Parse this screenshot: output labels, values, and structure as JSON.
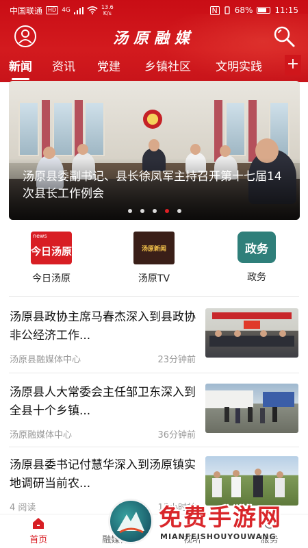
{
  "status_bar": {
    "carrier": "中国联通",
    "hd": "HD",
    "network": "4G",
    "speed_value": "13.6",
    "speed_unit": "K/s",
    "nfc": "N",
    "battery_percent": "68%",
    "time": "11:15"
  },
  "header": {
    "title": "汤原融媒"
  },
  "tabs": [
    {
      "label": "新闻",
      "active": true
    },
    {
      "label": "资讯",
      "active": false
    },
    {
      "label": "党建",
      "active": false
    },
    {
      "label": "乡镇社区",
      "active": false
    },
    {
      "label": "文明实践",
      "active": false
    }
  ],
  "tabs_more": "+",
  "banner": {
    "caption": "汤原县委副书记、县长徐凤军主持召开第十七届14次县长工作例会",
    "dots_total": 5,
    "active_dot": 4
  },
  "quick_entries": [
    {
      "label": "今日汤原",
      "logo_text": "今日汤原",
      "logo_small": "news",
      "icon": "jinri-tangyuan-logo"
    },
    {
      "label": "汤原TV",
      "logo_text": "汤原新闻",
      "icon": "tangyuan-tv-logo"
    },
    {
      "label": "政务",
      "logo_text": "政务",
      "icon": "zhengwu-logo"
    }
  ],
  "news": [
    {
      "title": "汤原县政协主席马春杰深入到县政协非公经济工作...",
      "source": "汤原县融媒体中心",
      "time": "23分钟前"
    },
    {
      "title": "汤原县人大常委会主任邹卫东深入到全县十个乡镇...",
      "source": "汤原融媒体中心",
      "time": "36分钟前"
    },
    {
      "title": "汤原县委书记付慧华深入到汤原镇实地调研当前农...",
      "source": "4 阅读",
      "time": "15小时前"
    }
  ],
  "bottom_nav": [
    {
      "label": "首页",
      "active": true,
      "icon": "home-icon"
    },
    {
      "label": "融媒体",
      "active": false,
      "icon": "media-icon"
    },
    {
      "label": "视听",
      "active": false,
      "icon": "video-icon"
    },
    {
      "label": "服务",
      "active": false,
      "icon": "service-icon"
    }
  ],
  "watermark": {
    "text": "免费手游网",
    "sub": "MIANFEISHOUYOUWANG"
  },
  "colors": {
    "brand_red": "#d31a1e",
    "active_dot": "#e02025",
    "meta_gray": "#999999"
  }
}
